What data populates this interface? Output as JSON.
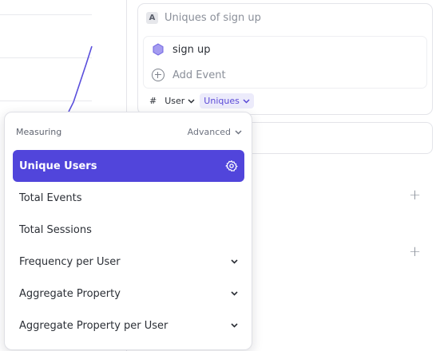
{
  "metric": {
    "letter": "A",
    "title": "Uniques of sign up",
    "event_name": "sign up",
    "add_event_label": "Add Event",
    "hash_symbol": "#",
    "user_label": "User",
    "uniques_label": "Uniques"
  },
  "dropdown": {
    "heading": "Measuring",
    "advanced_label": "Advanced",
    "items": [
      {
        "label": "Unique Users",
        "selected": true,
        "icon": "gear-icon"
      },
      {
        "label": "Total Events",
        "selected": false
      },
      {
        "label": "Total Sessions",
        "selected": false
      },
      {
        "label": "Frequency per User",
        "selected": false,
        "icon": "chevron-down-icon"
      },
      {
        "label": "Aggregate Property",
        "selected": false,
        "icon": "chevron-down-icon"
      },
      {
        "label": "Aggregate Property per User",
        "selected": false,
        "icon": "chevron-down-icon"
      }
    ]
  },
  "colors": {
    "accent": "#5145db",
    "accent_light": "#ecebfb",
    "event_hex": "#a59cf0"
  }
}
